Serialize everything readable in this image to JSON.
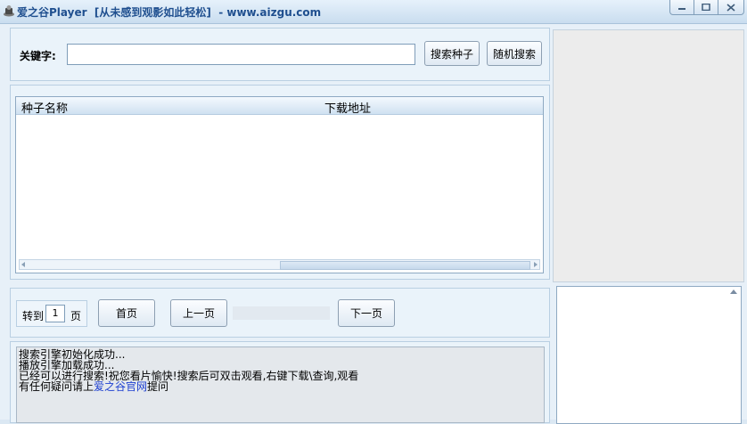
{
  "window": {
    "title": "爱之谷Player  [从未感到观影如此轻松]  - www.aizgu.com",
    "icons": {
      "app": "player-app-icon",
      "minimize": "minimize-icon",
      "maximize": "maximize-icon",
      "close": "close-icon"
    }
  },
  "search": {
    "keyword_label": "关键字:",
    "keyword_value": "",
    "search_button": "搜索种子",
    "random_button": "随机搜索"
  },
  "results": {
    "columns": [
      "种子名称",
      "下载地址"
    ],
    "rows": []
  },
  "pagination": {
    "goto_label": "转到",
    "page_value": "1",
    "page_unit": "页",
    "first_button": "首页",
    "prev_button": "上一页",
    "next_button": "下一页",
    "progress": 0
  },
  "log": {
    "line1": "搜索引擎初始化成功...",
    "line2": "播放引擎加载成功...",
    "line3": "已经可以进行搜索!祝您看片愉快!搜索后可双击观看,右键下载\\查询,观看",
    "line4_prefix": "有任何疑问请上",
    "line4_link": "爱之谷官网",
    "line4_suffix": "提问"
  },
  "colors": {
    "title": "#1f4f8f",
    "link": "#1d3fd0",
    "accent": "#6fa8dc"
  }
}
